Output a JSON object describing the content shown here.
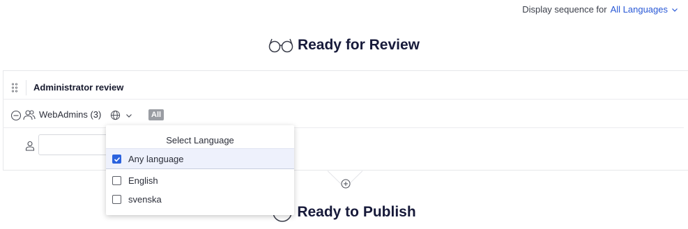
{
  "sequence": {
    "label": "Display sequence for",
    "selected_language": "All Languages"
  },
  "stages": {
    "review_title": "Ready for Review",
    "publish_title": "Ready to Publish"
  },
  "review_step": {
    "name": "Administrator review",
    "reviewer_group": "WebAdmins (3)",
    "language_badge": "All",
    "user_input_value": ""
  },
  "language_dropdown": {
    "title": "Select Language",
    "options": [
      {
        "label": "Any language",
        "checked": true
      },
      {
        "label": "English",
        "checked": false
      },
      {
        "label": "svenska",
        "checked": false
      }
    ]
  },
  "colors": {
    "accent": "#2858d6",
    "checkbox_checked": "#2b62de",
    "selected_row_bg": "#eef1fc",
    "badge_bg": "#9a9da3",
    "title_text": "#171a3a"
  },
  "icons": [
    "chevron-down-icon",
    "glasses-icon",
    "drag-handle-icon",
    "collapse-minus-icon",
    "people-icon",
    "globe-icon",
    "user-icon",
    "add-circle-icon",
    "stage-circle-icon",
    "check-icon"
  ]
}
